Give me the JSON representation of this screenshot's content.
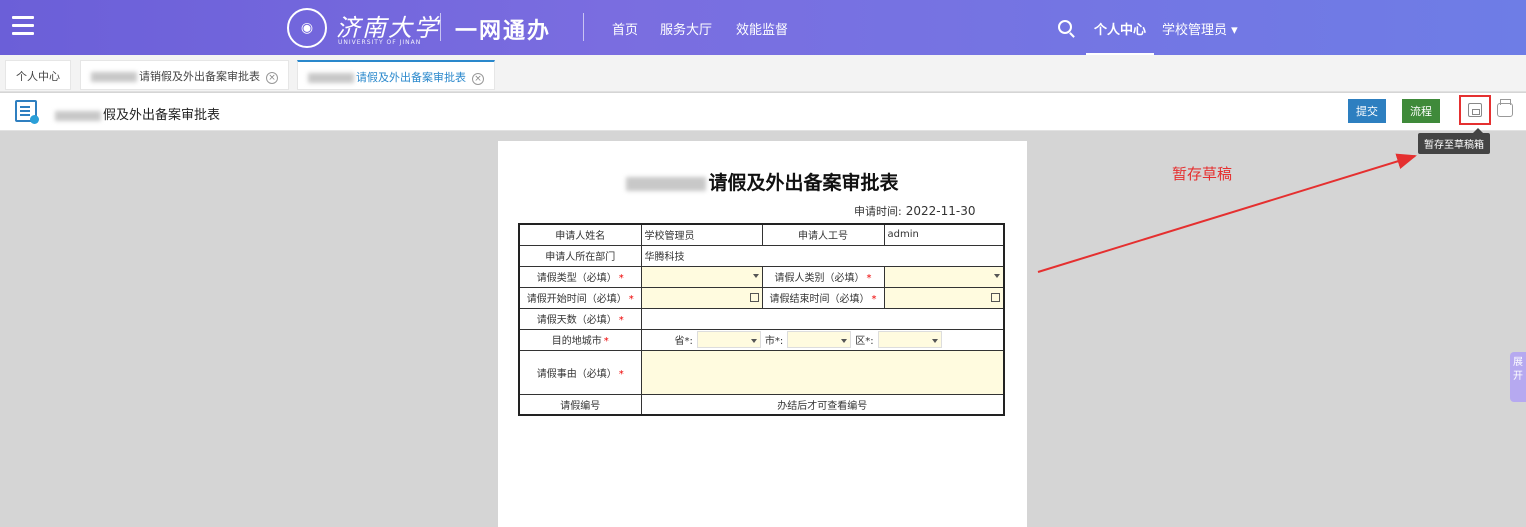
{
  "header": {
    "menu_icon": "hamburger-icon",
    "logo_name": "济南大学",
    "logo_sub": "UNIVERSITY OF JINAN",
    "app_title": "一网通办",
    "nav": [
      "首页",
      "服务大厅",
      "效能监督"
    ],
    "user_center": "个人中心",
    "school_admin": "学校管理员 ▾"
  },
  "tabs": [
    {
      "label": "个人中心"
    },
    {
      "label": "请销假及外出备案审批表"
    },
    {
      "label": "请假及外出备案审批表"
    }
  ],
  "toolbar": {
    "title": "假及外出备案审批表",
    "submit": "提交",
    "flow": "流程",
    "save_tooltip": "暂存至草稿箱"
  },
  "form": {
    "title": "请假及外出备案审批表",
    "apply_time_label": "申请时间:",
    "apply_time_value": "2022-11-30",
    "name_label": "申请人姓名",
    "name_value": "学校管理员",
    "id_label": "申请人工号",
    "id_value": "admin",
    "dept_label": "申请人所在部门",
    "dept_value": "华腾科技",
    "leave_type_label": "请假类型（必填）",
    "leaver_kind_label": "请假人类别（必填）",
    "start_label": "请假开始时间（必填）",
    "end_label": "请假结束时间（必填）",
    "days_label": "请假天数（必填）",
    "dest_label": "目的地城市",
    "prov_label": "省*:",
    "city_label": "市*:",
    "district_label": "区*:",
    "reason_label": "请假事由（必填）",
    "code_label": "请假编号",
    "code_value": "办结后才可查看编号"
  },
  "annotation": {
    "text": "暂存草稿",
    "color": "#e53030"
  },
  "side_tab": "展开"
}
